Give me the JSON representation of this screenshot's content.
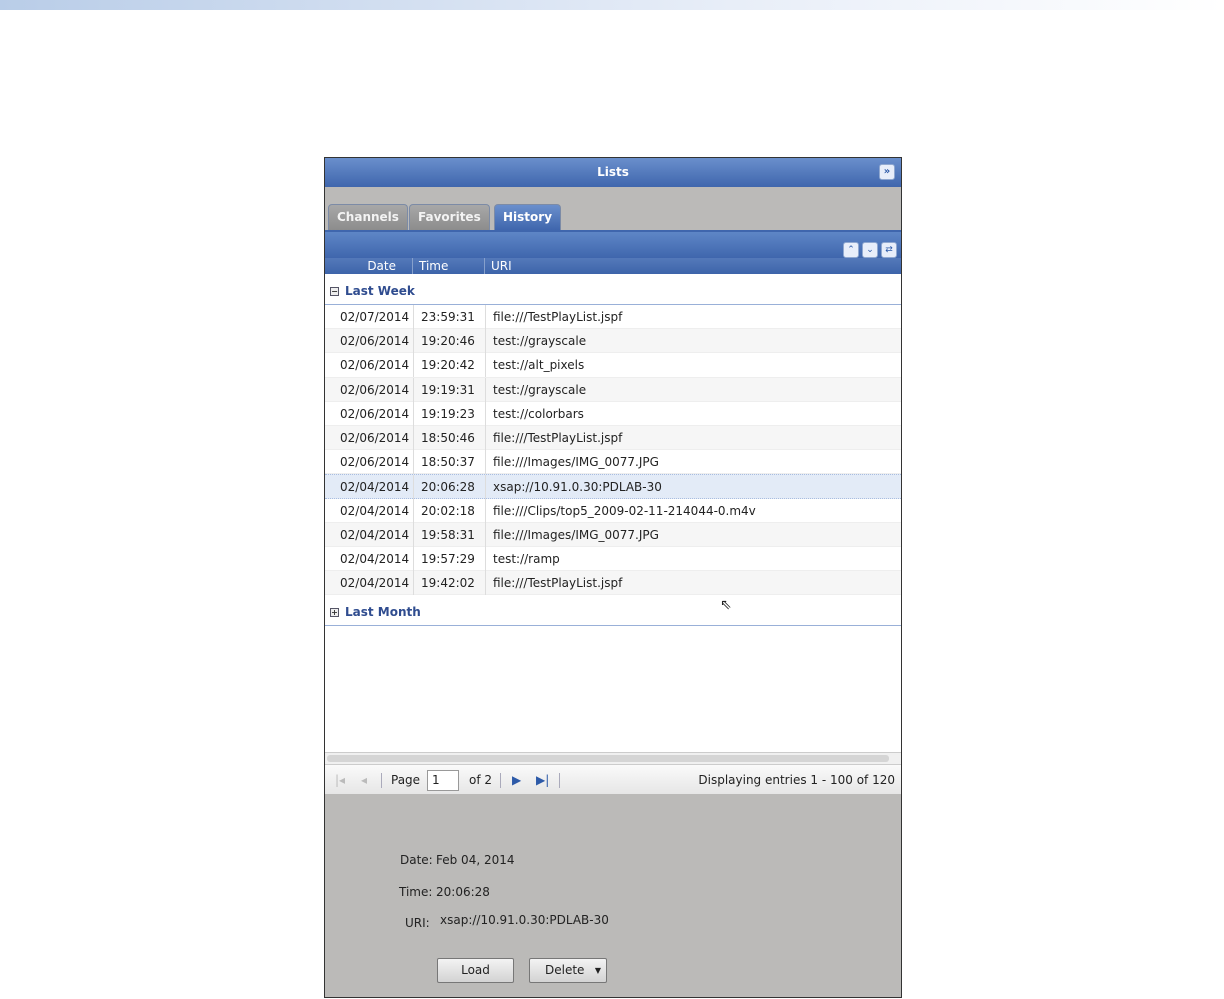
{
  "panel": {
    "title": "Lists",
    "collapse_icon": "double-chevron-right"
  },
  "tabs": [
    {
      "label": "Channels"
    },
    {
      "label": "Favorites"
    },
    {
      "label": "History",
      "active": true
    }
  ],
  "columns": [
    "Date",
    "Time",
    "URI"
  ],
  "groups": [
    {
      "label": "Last Week",
      "expanded": true
    },
    {
      "label": "Last Month",
      "expanded": false
    }
  ],
  "rows": [
    {
      "date": "02/07/2014",
      "time": "23:59:31",
      "uri": "file:///TestPlayList.jspf"
    },
    {
      "date": "02/06/2014",
      "time": "19:20:46",
      "uri": "test://grayscale"
    },
    {
      "date": "02/06/2014",
      "time": "19:20:42",
      "uri": "test://alt_pixels"
    },
    {
      "date": "02/06/2014",
      "time": "19:19:31",
      "uri": "test://grayscale"
    },
    {
      "date": "02/06/2014",
      "time": "19:19:23",
      "uri": "test://colorbars"
    },
    {
      "date": "02/06/2014",
      "time": "18:50:46",
      "uri": "file:///TestPlayList.jspf"
    },
    {
      "date": "02/06/2014",
      "time": "18:50:37",
      "uri": "file:///Images/IMG_0077.JPG"
    },
    {
      "date": "02/04/2014",
      "time": "20:06:28",
      "uri": "xsap://10.91.0.30:PDLAB-30",
      "selected": true
    },
    {
      "date": "02/04/2014",
      "time": "20:02:18",
      "uri": "file:///Clips/top5_2009-02-11-214044-0.m4v"
    },
    {
      "date": "02/04/2014",
      "time": "19:58:31",
      "uri": "file:///Images/IMG_0077.JPG"
    },
    {
      "date": "02/04/2014",
      "time": "19:57:29",
      "uri": "test://ramp"
    },
    {
      "date": "02/04/2014",
      "time": "19:42:02",
      "uri": "file:///TestPlayList.jspf"
    }
  ],
  "pager": {
    "page_label": "Page",
    "page_value": "1",
    "of_label": "of 2",
    "display": "Displaying entries 1 - 100 of 120"
  },
  "details": {
    "date_label": "Date:",
    "date": "Feb 04, 2014",
    "time_label": "Time:",
    "time": "20:06:28",
    "uri_label": "URI:",
    "uri": "xsap://10.91.0.30:PDLAB-30",
    "load": "Load",
    "delete": "Delete"
  }
}
